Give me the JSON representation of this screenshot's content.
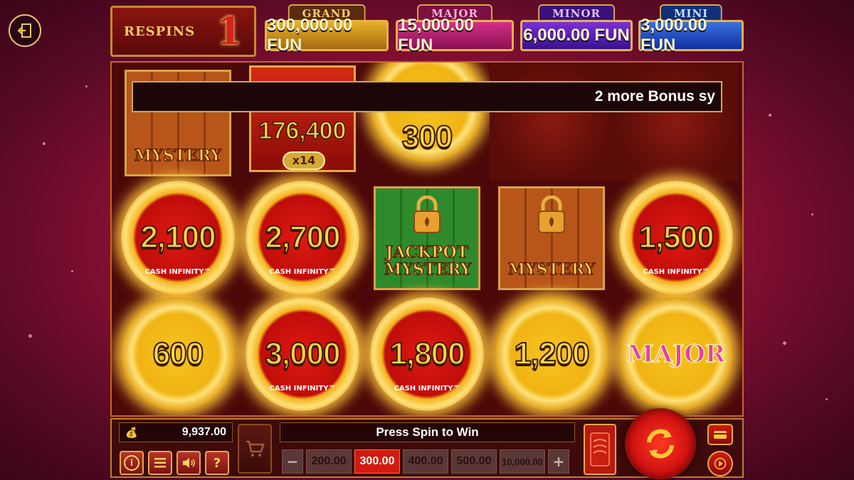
{
  "respins": {
    "label": "RESPINS",
    "count": "1"
  },
  "jackpots": [
    {
      "name": "GRAND",
      "value": "300,000.00 FUN",
      "color": "#e0a020"
    },
    {
      "name": "MAJOR",
      "value": "15,000.00 FUN",
      "color": "#c0207a"
    },
    {
      "name": "MINOR",
      "value": "6,000.00 FUN",
      "color": "#5a20c0"
    },
    {
      "name": "MINI",
      "value": "3,000.00 FUN",
      "color": "#2050c0"
    }
  ],
  "message": "2 more Bonus sy",
  "top_row": {
    "mystery_label": "MYSTERY",
    "chest_value": "176,400",
    "chest_multiplier": "x14",
    "coin_value": "300"
  },
  "middle_row": [
    {
      "type": "red-coin",
      "value": "2,100",
      "sub": "CASH INFINITY™"
    },
    {
      "type": "red-coin",
      "value": "2,700",
      "sub": "CASH INFINITY™"
    },
    {
      "type": "green-crate",
      "label": "JACKPOT MYSTERY"
    },
    {
      "type": "brown-crate",
      "label": "MYSTERY"
    },
    {
      "type": "red-coin",
      "value": "1,500",
      "sub": "CASH INFINITY™"
    }
  ],
  "bottom_row": [
    {
      "type": "gold-coin",
      "value": "600"
    },
    {
      "type": "red-coin",
      "value": "3,000",
      "sub": "CASH INFINITY™"
    },
    {
      "type": "red-coin",
      "value": "1,800",
      "sub": "CASH INFINITY™"
    },
    {
      "type": "gold-coin",
      "value": "1,200"
    },
    {
      "type": "gold-coin",
      "value": "MAJOR"
    }
  ],
  "balance": "9,937.00",
  "status": "Press Spin to Win",
  "bets": [
    "200.00",
    "300.00",
    "400.00",
    "500.00",
    "10,000.00"
  ],
  "selected_bet": "300.00",
  "controls": {
    "info": "i",
    "help": "?",
    "minus": "−",
    "plus": "+"
  }
}
